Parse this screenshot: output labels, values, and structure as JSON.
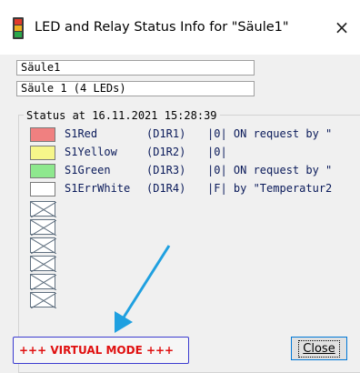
{
  "window": {
    "title": "LED and Relay Status Info for \"Säule1\"",
    "close_glyph": "×",
    "icon": "traffic-light-icon"
  },
  "fields": {
    "name_value": "Säule1",
    "description_value": "Säule 1 (4 LEDs)"
  },
  "status": {
    "label": "Status at 16.11.2021 15:28:39",
    "leds": [
      {
        "name": "S1Red",
        "relay": "(D1R1)",
        "status": "|0| ON request by \"",
        "color": "#f08080"
      },
      {
        "name": "S1Yellow",
        "relay": "(D1R2)",
        "status": "|0|",
        "color": "#f6f68a"
      },
      {
        "name": "S1Green",
        "relay": "(D1R3)",
        "status": "|0| ON request by \"",
        "color": "#8ee88e"
      },
      {
        "name": "S1ErrWhite",
        "relay": "(D1R4)",
        "status": "|F| by \"Temperatur2",
        "color": "#ffffff"
      }
    ],
    "empty_slots": 6
  },
  "footer": {
    "virtual_mode": "+++ VIRTUAL MODE +++",
    "close_label": "Close"
  },
  "colors": {
    "accent_blue": "#1fa0e0",
    "virtual_mode_text": "#e01010",
    "virtual_mode_border": "#3b3bd0"
  }
}
